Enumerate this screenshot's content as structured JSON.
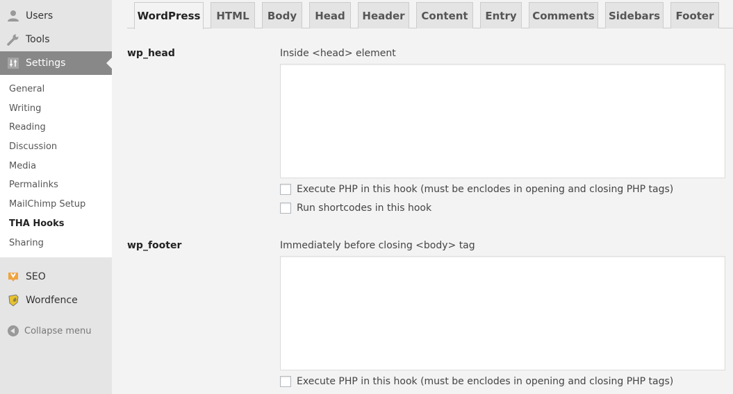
{
  "sidebar": {
    "top_items": [
      {
        "label": "Users",
        "icon": "users-icon"
      },
      {
        "label": "Tools",
        "icon": "wrench-icon"
      },
      {
        "label": "Settings",
        "icon": "settings-sliders-icon",
        "current": true
      }
    ],
    "submenu": [
      {
        "label": "General"
      },
      {
        "label": "Writing"
      },
      {
        "label": "Reading"
      },
      {
        "label": "Discussion"
      },
      {
        "label": "Media"
      },
      {
        "label": "Permalinks"
      },
      {
        "label": "MailChimp Setup"
      },
      {
        "label": "THA Hooks",
        "active": true
      },
      {
        "label": "Sharing"
      }
    ],
    "bottom_items": [
      {
        "label": "SEO",
        "icon": "yoast-seo-icon"
      },
      {
        "label": "Wordfence",
        "icon": "wordfence-shield-icon"
      }
    ],
    "collapse_label": "Collapse menu",
    "colors": {
      "current_bg": "#888888",
      "seo_icon": "#f0a340",
      "wordfence_icon": "#e8c330"
    }
  },
  "tabs": [
    {
      "label": "WordPress",
      "active": true
    },
    {
      "label": "HTML"
    },
    {
      "label": "Body"
    },
    {
      "label": "Head"
    },
    {
      "label": "Header"
    },
    {
      "label": "Content"
    },
    {
      "label": "Entry"
    },
    {
      "label": "Comments"
    },
    {
      "label": "Sidebars"
    },
    {
      "label": "Footer"
    }
  ],
  "hooks": [
    {
      "name": "wp_head",
      "description": "Inside <head> element",
      "value": "",
      "options": [
        {
          "label": "Execute PHP in this hook (must be enclodes in opening and closing PHP tags)",
          "checked": false
        },
        {
          "label": "Run shortcodes in this hook",
          "checked": false
        }
      ]
    },
    {
      "name": "wp_footer",
      "description": "Immediately before closing <body> tag",
      "value": "",
      "options": [
        {
          "label": "Execute PHP in this hook (must be enclodes in opening and closing PHP tags)",
          "checked": false
        }
      ]
    }
  ]
}
